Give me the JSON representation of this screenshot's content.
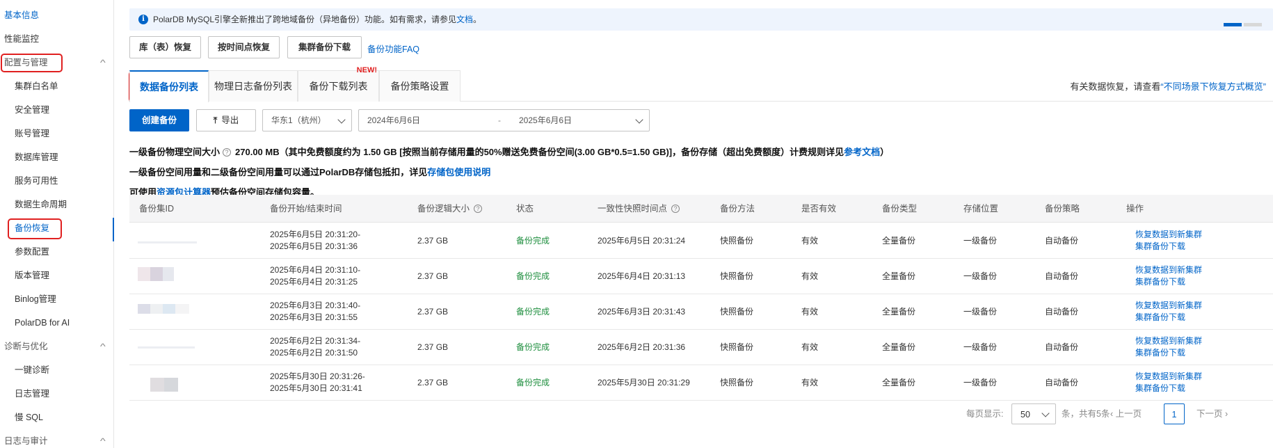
{
  "sidebar": {
    "items": [
      {
        "label": "基本信息"
      },
      {
        "label": "性能监控"
      },
      {
        "label": "配置与管理"
      },
      {
        "label": "集群白名单"
      },
      {
        "label": "安全管理"
      },
      {
        "label": "账号管理"
      },
      {
        "label": "数据库管理"
      },
      {
        "label": "服务可用性"
      },
      {
        "label": "数据生命周期"
      },
      {
        "label": "备份恢复"
      },
      {
        "label": "参数配置"
      },
      {
        "label": "版本管理"
      },
      {
        "label": "Binlog管理"
      },
      {
        "label": "PolarDB for AI"
      },
      {
        "label": "诊断与优化"
      },
      {
        "label": "一键诊断"
      },
      {
        "label": "日志管理"
      },
      {
        "label": "慢 SQL"
      },
      {
        "label": "日志与审计"
      }
    ]
  },
  "notice": {
    "text": "PolarDB MySQL引擎全新推出了跨地域备份（异地备份）功能。如有需求，请参见",
    "link": "文档",
    "end": "。"
  },
  "actions": {
    "restore_db": "库（表）恢复",
    "restore_pitr": "按时间点恢复",
    "download": "集群备份下载",
    "faq": "备份功能FAQ"
  },
  "tabs": [
    {
      "label": "数据备份列表"
    },
    {
      "label": "物理日志备份列表"
    },
    {
      "label": "备份下载列表",
      "badge": "NEW!"
    },
    {
      "label": "备份策略设置"
    }
  ],
  "right_tip": {
    "prefix": "有关数据恢复，请查看",
    "link": "“不同场景下恢复方式概览”"
  },
  "toolbar": {
    "create": "创建备份",
    "export": "导出",
    "region": "华东1（杭州）",
    "date_start": "2024年6月6日",
    "date_sep": "-",
    "date_end": "2025年6月6日"
  },
  "info": {
    "line1_label": "一级备份物理空间大小",
    "line1_value": "270.00 MB（其中免费额度约为 1.50 GB [按照当前存储用量的50%赠送免费备份空间(3.00 GB*0.5=1.50 GB)]，备份存储（超出免费额度）计费规则详见",
    "line1_link": "参考文档",
    "line1_end": "）",
    "line2_text": "一级备份空间用量和二级备份空间用量可以通过PolarDB存储包抵扣，详见",
    "line2_link": "存储包使用说明",
    "line3_prefix": "可使用",
    "line3_link": "资源包计算器",
    "line3_suffix": "预估备份空间存储包容量。"
  },
  "table": {
    "headers": [
      "备份集ID",
      "备份开始/结束时间",
      "备份逻辑大小",
      "状态",
      "一致性快照时间点",
      "备份方法",
      "是否有效",
      "备份类型",
      "存储位置",
      "备份策略",
      "操作"
    ],
    "rows": [
      {
        "start": "2025年6月5日 20:31:20-",
        "end": "2025年6月5日 20:31:36",
        "size": "2.37 GB",
        "status": "备份完成",
        "snapshot": "2025年6月5日 20:31:24",
        "method": "快照备份",
        "valid": "有效",
        "type": "全量备份",
        "location": "一级备份",
        "policy": "自动备份",
        "op1": "恢复数据到新集群",
        "op2": "集群备份下载"
      },
      {
        "start": "2025年6月4日 20:31:10-",
        "end": "2025年6月4日 20:31:25",
        "size": "2.37 GB",
        "status": "备份完成",
        "snapshot": "2025年6月4日 20:31:13",
        "method": "快照备份",
        "valid": "有效",
        "type": "全量备份",
        "location": "一级备份",
        "policy": "自动备份",
        "op1": "恢复数据到新集群",
        "op2": "集群备份下载"
      },
      {
        "start": "2025年6月3日 20:31:40-",
        "end": "2025年6月3日 20:31:55",
        "size": "2.37 GB",
        "status": "备份完成",
        "snapshot": "2025年6月3日 20:31:43",
        "method": "快照备份",
        "valid": "有效",
        "type": "全量备份",
        "location": "一级备份",
        "policy": "自动备份",
        "op1": "恢复数据到新集群",
        "op2": "集群备份下载"
      },
      {
        "start": "2025年6月2日 20:31:34-",
        "end": "2025年6月2日 20:31:50",
        "size": "2.37 GB",
        "status": "备份完成",
        "snapshot": "2025年6月2日 20:31:36",
        "method": "快照备份",
        "valid": "有效",
        "type": "全量备份",
        "location": "一级备份",
        "policy": "自动备份",
        "op1": "恢复数据到新集群",
        "op2": "集群备份下载"
      },
      {
        "start": "2025年5月30日 20:31:26-",
        "end": "2025年5月30日 20:31:41",
        "size": "2.37 GB",
        "status": "备份完成",
        "snapshot": "2025年5月30日 20:31:29",
        "method": "快照备份",
        "valid": "有效",
        "type": "全量备份",
        "location": "一级备份",
        "policy": "自动备份",
        "op1": "恢复数据到新集群",
        "op2": "集群备份下载"
      }
    ]
  },
  "pagination": {
    "page_size_label": "每页显示:",
    "page_size": "50",
    "total": "条，共有5条",
    "prev": "上一页",
    "current": "1",
    "next": "下一页"
  },
  "colors": {
    "primary": "#0064c8",
    "success": "#1e8e3e",
    "highlight": "#e02020"
  }
}
